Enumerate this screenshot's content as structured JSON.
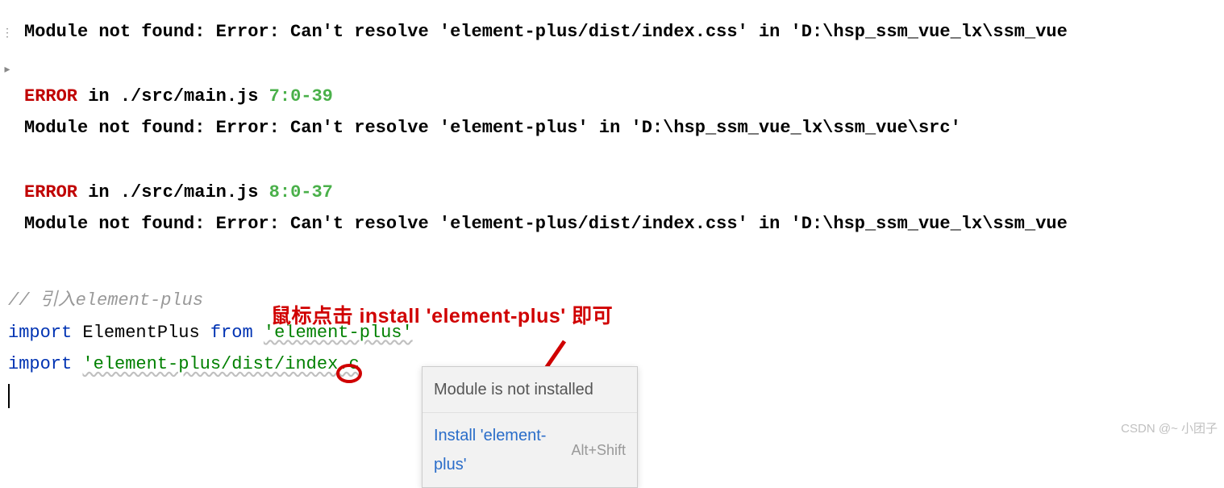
{
  "terminal": {
    "line1": {
      "prefix": "Module not found: Error: Can't resolve 'element-plus/dist/index.css' in 'D:\\hsp_ssm_vue_lx\\ssm_vue"
    },
    "error1": {
      "label": "ERROR",
      "in": " in ",
      "file": "./src/main.js",
      "loc": " 7:0-39"
    },
    "line2": "Module not found: Error: Can't resolve 'element-plus' in 'D:\\hsp_ssm_vue_lx\\ssm_vue\\src'",
    "error2": {
      "label": "ERROR",
      "in": " in ",
      "file": "./src/main.js",
      "loc": " 8:0-37"
    },
    "line3": "Module not found: Error: Can't resolve 'element-plus/dist/index.css' in 'D:\\hsp_ssm_vue_lx\\ssm_vue"
  },
  "editor": {
    "comment_prefix": "// ",
    "comment_text": "引入element-plus",
    "import1": {
      "kw1": "import",
      "mid": " ElementPlus ",
      "kw2": "from",
      "sp": " ",
      "str": "'element-plus'"
    },
    "import2": {
      "kw1": "import",
      "sp": " ",
      "str": "'element-plus/dist/index.c"
    },
    "faded_line": "// ..."
  },
  "callout": {
    "pre": "鼠标点击 ",
    "mid": "install 'element-plus'",
    "post": " 即可"
  },
  "tooltip": {
    "header": "Module is not installed",
    "action": "Install 'element-plus'",
    "shortcut": "Alt+Shift"
  },
  "watermark": "CSDN @~ 小团子"
}
